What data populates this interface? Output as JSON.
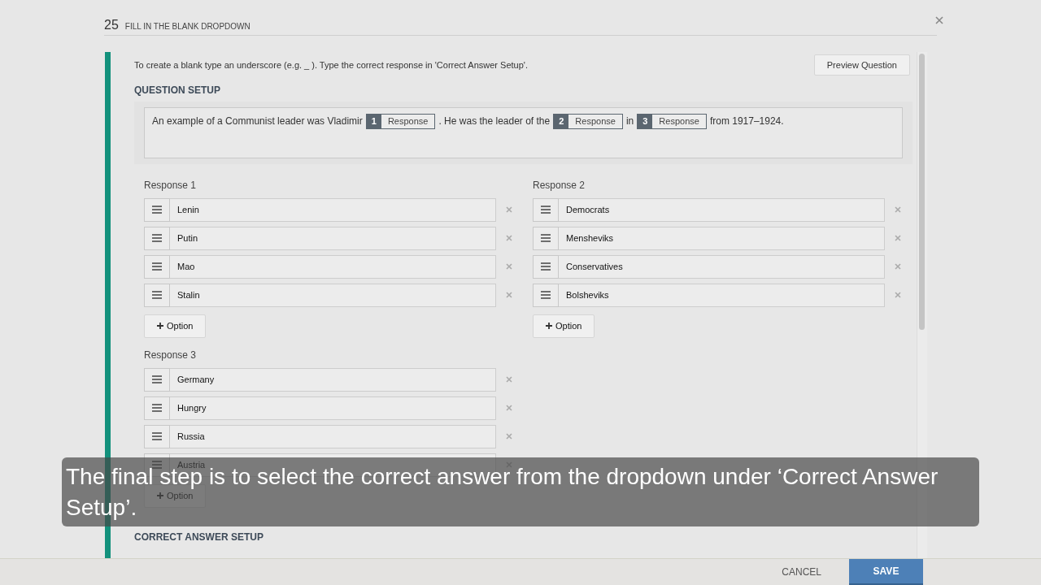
{
  "dialog": {
    "number": "25",
    "title": "FILL IN THE BLANK DROPDOWN"
  },
  "instructions": "To create a blank type an underscore (e.g. _ ). Type the correct response in 'Correct Answer Setup'.",
  "preview_button": "Preview Question",
  "question_setup": {
    "heading": "QUESTION SETUP",
    "sentence": [
      {
        "kind": "text",
        "text": "An example of a Communist leader was Vladimir"
      },
      {
        "kind": "blank",
        "number": "1",
        "label": "Response"
      },
      {
        "kind": "text",
        "text": ". He was the leader of the"
      },
      {
        "kind": "blank",
        "number": "2",
        "label": "Response"
      },
      {
        "kind": "text",
        "text": "in"
      },
      {
        "kind": "blank",
        "number": "3",
        "label": "Response"
      },
      {
        "kind": "text",
        "text": "from 1917–1924."
      }
    ]
  },
  "responses": [
    {
      "label": "Response 1",
      "options": [
        "Lenin",
        "Putin",
        "Mao",
        "Stalin"
      ],
      "add_button": "Option"
    },
    {
      "label": "Response 2",
      "options": [
        "Democrats",
        "Mensheviks",
        "Conservatives",
        "Bolsheviks"
      ],
      "add_button": "Option"
    },
    {
      "label": "Response 3",
      "options": [
        "Germany",
        "Hungry",
        "Russia",
        "Austria"
      ],
      "add_button": "Option"
    }
  ],
  "correct_answer_setup": {
    "heading": "CORRECT ANSWER SETUP"
  },
  "footer": {
    "cancel": "CANCEL",
    "save": "SAVE"
  },
  "caption": "The final step is to select the correct answer from the dropdown under ‘Correct Answer Setup’."
}
